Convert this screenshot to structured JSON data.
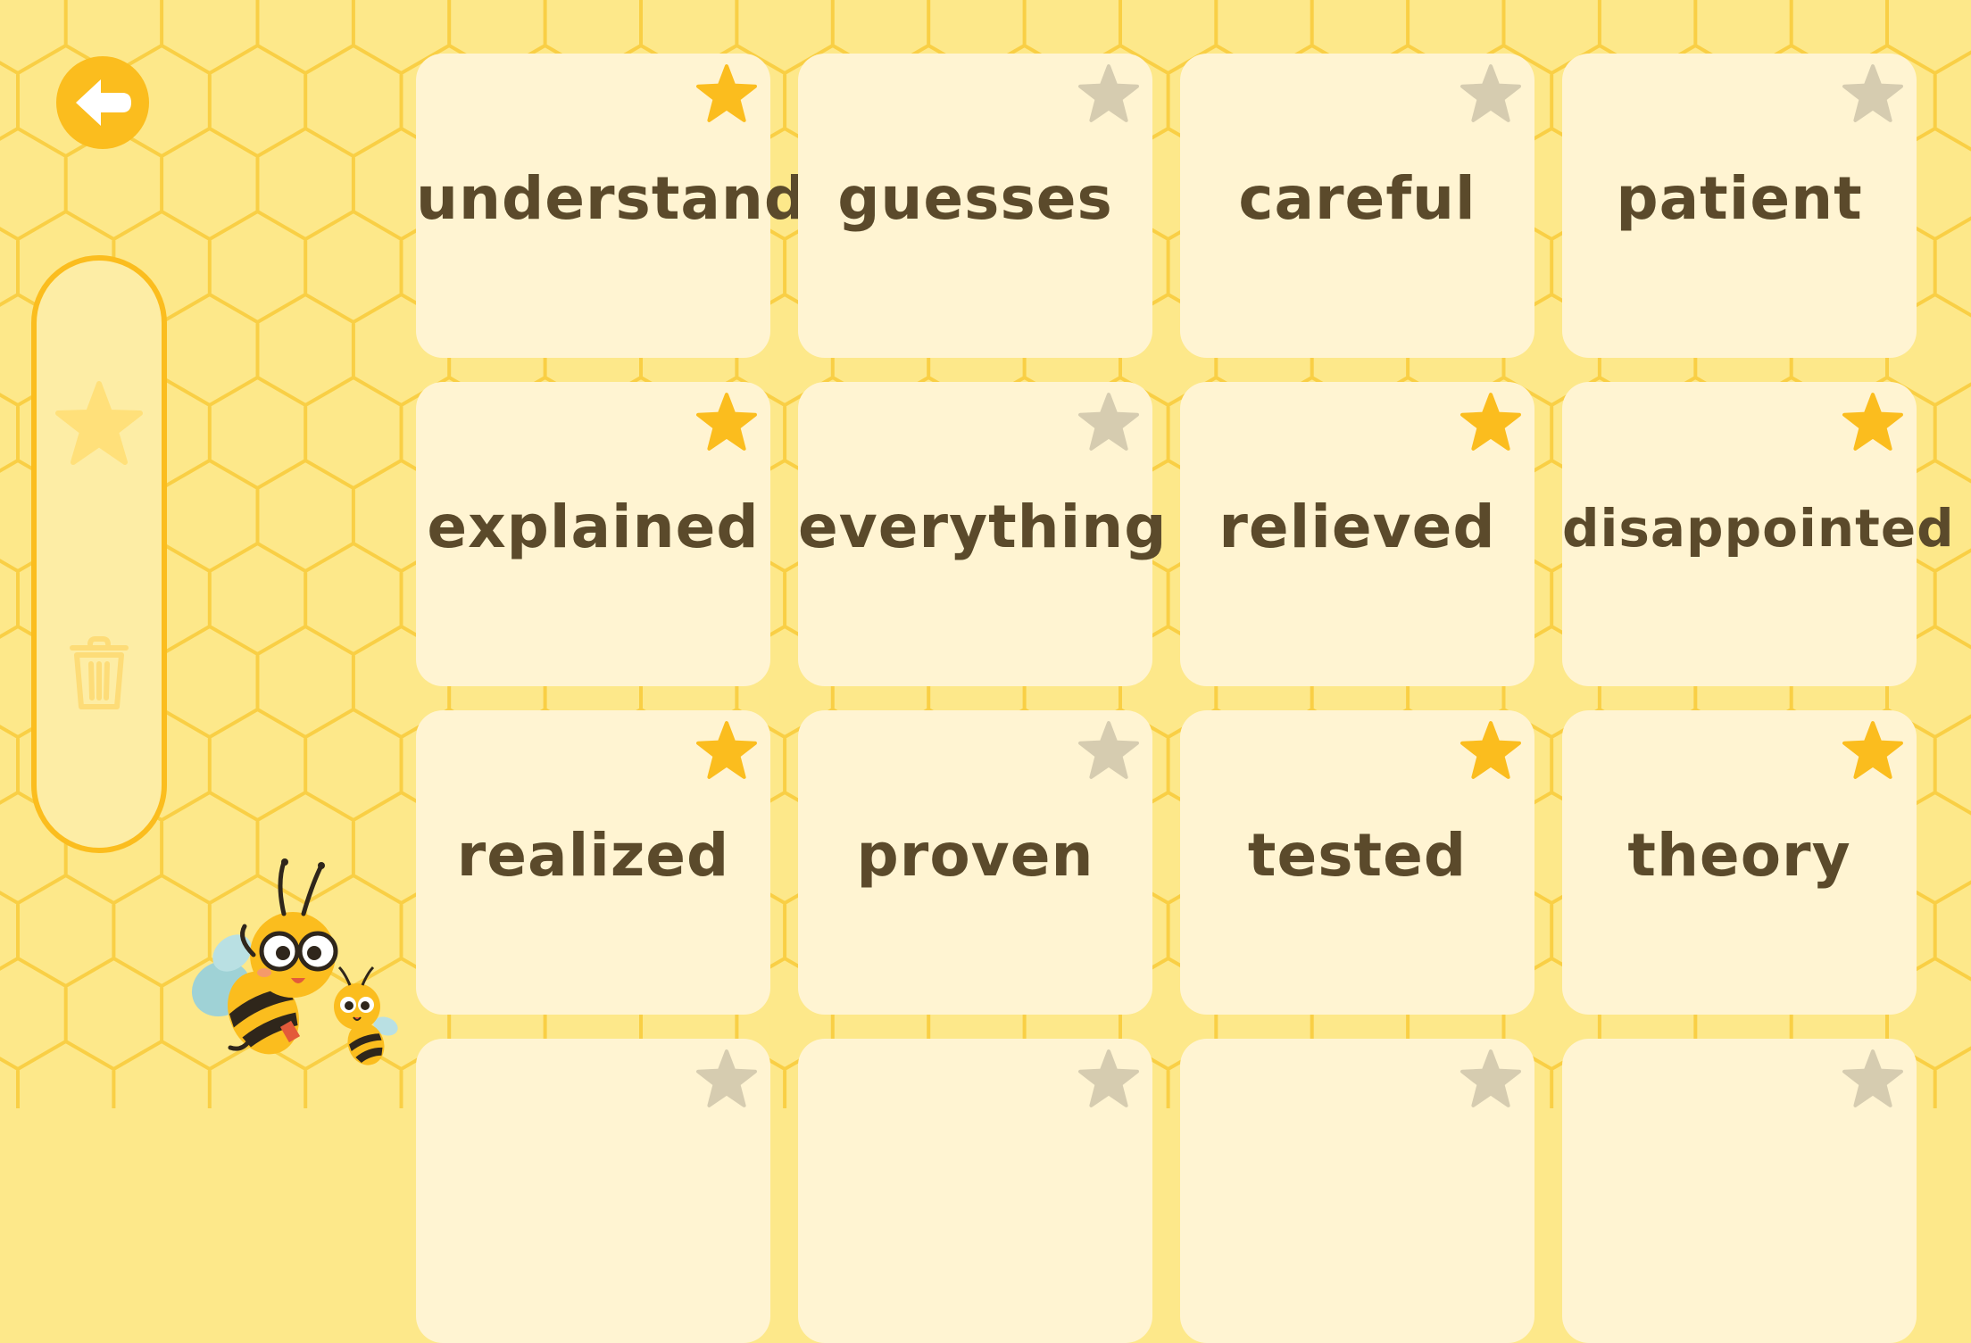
{
  "colors": {
    "background": "#fde88a",
    "accent": "#fbbd1e",
    "card": "#fff4d2",
    "text": "#5b4a2b",
    "star_active": "#fbbd1e",
    "star_inactive": "#d6ccb0"
  },
  "back_button": {
    "icon": "arrow-left-icon"
  },
  "side_panel": {
    "favorites_icon": "star-icon",
    "delete_icon": "trash-icon"
  },
  "cards": [
    {
      "word": "understand",
      "starred": true
    },
    {
      "word": "guesses",
      "starred": false
    },
    {
      "word": "careful",
      "starred": false
    },
    {
      "word": "patient",
      "starred": false
    },
    {
      "word": "explained",
      "starred": true
    },
    {
      "word": "everything",
      "starred": false
    },
    {
      "word": "relieved",
      "starred": true
    },
    {
      "word": "disappointed",
      "starred": true
    },
    {
      "word": "realized",
      "starred": true
    },
    {
      "word": "proven",
      "starred": false
    },
    {
      "word": "tested",
      "starred": true
    },
    {
      "word": "theory",
      "starred": true
    },
    {
      "word": "",
      "starred": false
    },
    {
      "word": "",
      "starred": false
    },
    {
      "word": "",
      "starred": false
    },
    {
      "word": "",
      "starred": false
    }
  ]
}
